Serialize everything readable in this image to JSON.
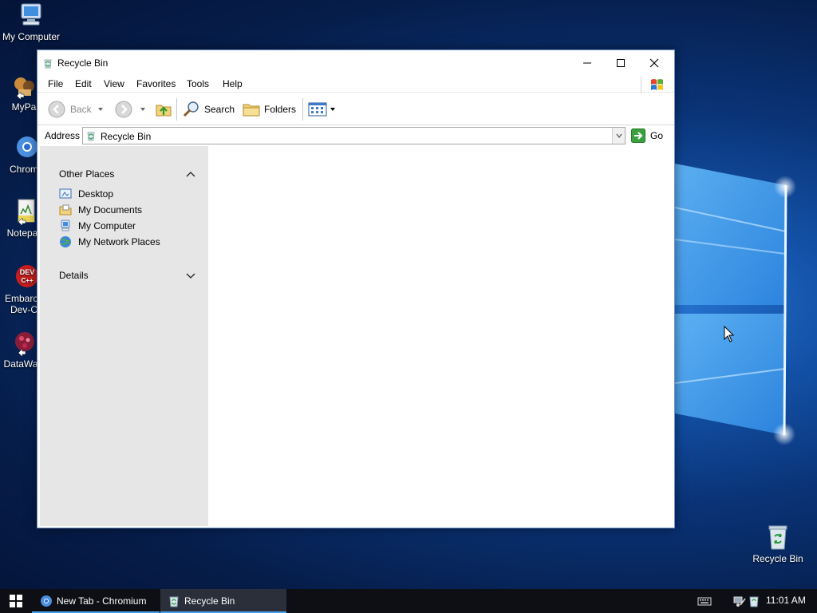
{
  "desktop": {
    "icons": [
      {
        "label": "My Computer",
        "icon": "my-computer-icon"
      },
      {
        "label": "MyPa",
        "icon": "mypa-icon"
      },
      {
        "label": "Chrom",
        "icon": "chromium-icon"
      },
      {
        "label": "Notepa",
        "icon": "notepad-icon"
      },
      {
        "label": "Embarca\nDev-C",
        "icon": "embarcadero-devcpp-icon"
      },
      {
        "label": "DataWa",
        "icon": "datawa-icon"
      },
      {
        "label": "Recycle Bin",
        "icon": "recycle-bin-icon"
      }
    ]
  },
  "window": {
    "title": "Recycle Bin",
    "controls": {
      "minimize": "minimize-icon",
      "maximize": "maximize-icon",
      "close": "close-icon"
    },
    "menu": [
      "File",
      "Edit",
      "View",
      "Favorites",
      "Tools",
      "Help"
    ],
    "toolbar": {
      "back": "Back",
      "search": "Search",
      "folders": "Folders"
    },
    "address": {
      "label": "Address",
      "value": "Recycle Bin",
      "go": "Go"
    },
    "tasks_pane": {
      "other_places": {
        "header": "Other Places",
        "items": [
          "Desktop",
          "My Documents",
          "My Computer",
          "My Network Places"
        ]
      },
      "details": {
        "header": "Details"
      }
    }
  },
  "taskbar": {
    "tasks": [
      {
        "label": "New Tab - Chromium",
        "icon": "chromium-icon"
      },
      {
        "label": "Recycle Bin",
        "icon": "recycle-bin-icon",
        "active": true
      }
    ],
    "clock": "11:01 AM"
  },
  "colors": {
    "taskbar": "#0d0f14",
    "active_task": "#2a2f3a",
    "task_indicator": "#4aa0e8",
    "tasks_pane": "#e6e6e6"
  }
}
